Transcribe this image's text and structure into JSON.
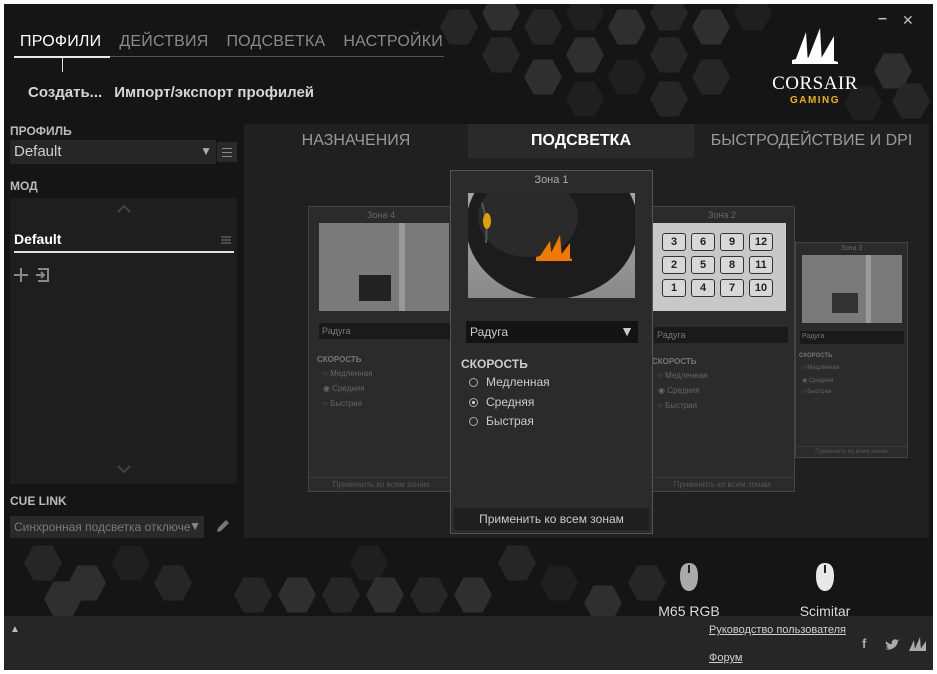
{
  "nav": {
    "items": [
      {
        "label": "ПРОФИЛИ",
        "active": true
      },
      {
        "label": "ДЕЙСТВИЯ",
        "active": false
      },
      {
        "label": "ПОДСВЕТКА",
        "active": false
      },
      {
        "label": "НАСТРОЙКИ",
        "active": false
      }
    ]
  },
  "subactions": {
    "create": "Создать...",
    "import_export": "Импорт/экспорт профилей"
  },
  "window": {
    "minimize": "–",
    "close": "✕"
  },
  "logo": {
    "brand": "CORSAIR",
    "sub": "GAMING",
    "accent": "#f0b400"
  },
  "left": {
    "profile_label": "ПРОФИЛЬ",
    "profile_value": "Default",
    "mode_label": "МОД",
    "mode_value": "Default",
    "cue_link_label": "CUE LINK",
    "cue_link_value": "Синхронная подсветка отключе"
  },
  "tabs": [
    {
      "label": "НАЗНАЧЕНИЯ",
      "active": false
    },
    {
      "label": "ПОДСВЕТКА",
      "active": true
    },
    {
      "label": "БЫСТРОДЕЙСТВИЕ И DPI",
      "active": false
    }
  ],
  "zones": {
    "main": {
      "title": "Зона 1",
      "effect": "Радуга",
      "speed_label": "СКОРОСТЬ",
      "options": [
        "Медленная",
        "Средняя",
        "Быстрая"
      ],
      "selected": "Средняя",
      "apply": "Применить ко всем зонам"
    },
    "zone4": {
      "title": "Зона 4",
      "effect": "Радуга",
      "speed_label": "СКОРОСТЬ",
      "options": [
        "Медленная",
        "Средняя",
        "Быстрая"
      ],
      "apply": "Применить ко всем зонам"
    },
    "zone2": {
      "title": "Зона 2",
      "effect": "Радуга",
      "speed_label": "СКОРОСТЬ",
      "options": [
        "Медленная",
        "Средняя",
        "Быстрая"
      ],
      "apply": "Применить ко всем зонам",
      "keys": [
        "3",
        "6",
        "9",
        "12",
        "2",
        "5",
        "8",
        "11",
        "1",
        "4",
        "7",
        "10"
      ]
    },
    "zone3": {
      "title": "Зона 3",
      "effect": "Радуга",
      "speed_label": "СКОРОСТЬ",
      "options": [
        "Медленная",
        "Средняя",
        "Быстрая"
      ],
      "apply": "Применить ко всем зонам"
    }
  },
  "devices": [
    {
      "name": "M65 RGB",
      "icon": "mouse-icon"
    },
    {
      "name": "Scimitar",
      "icon": "mouse-icon"
    }
  ],
  "footer": {
    "expand": "▲",
    "manual": "Руководство пользователя",
    "forum": "Форум",
    "social": [
      "f",
      "twitter",
      "corsair"
    ]
  },
  "colors": {
    "accent_orange": "#f07a00",
    "background": "#151515"
  }
}
